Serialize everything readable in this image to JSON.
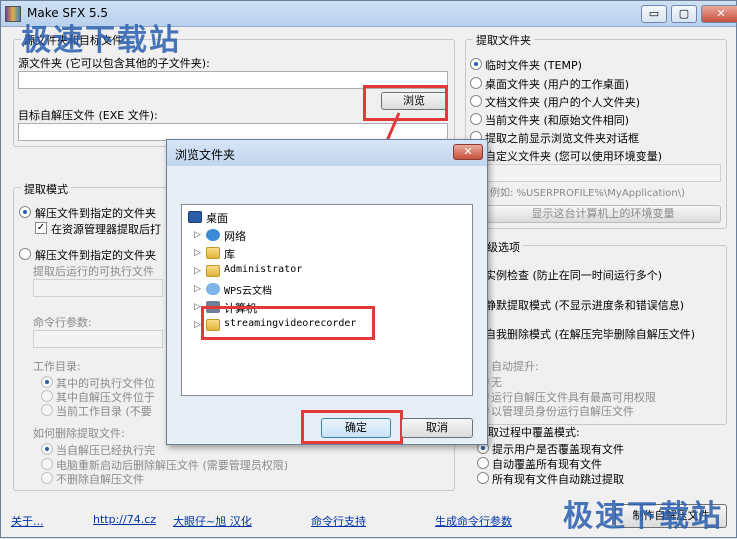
{
  "window": {
    "title": "Make SFX 5.5",
    "minimize": "▭",
    "maximize": "▢",
    "close": "✕"
  },
  "watermark": "极速下载站",
  "source_group": {
    "label": "源文件夹和目标文件",
    "source_label": "源文件夹 (它可以包含其他的子文件夹):",
    "browse_button": "浏览",
    "target_label": "目标自解压文件 (EXE 文件):"
  },
  "extract_mode": {
    "label": "提取模式",
    "opt1": "解压文件到指定的文件夹",
    "opt1_check": "在资源管理器提取后打",
    "opt2": "解压文件到指定的文件夹",
    "run_label": "提取后运行的可执行文件",
    "cmd_label": "命令行参数:",
    "workdir_label": "工作目录:",
    "wd1": "其中的可执行文件位",
    "wd2": "其中自解压文件位于",
    "wd3": "当前工作目录 (不要",
    "delete_label": "如何删除提取文件:",
    "del1": "当自解压已经执行完",
    "del2": "电脑重新启动后删除解压文件 (需要管理员权限)",
    "del3": "不删除自解压文件"
  },
  "extract_folder": {
    "label": "提取文件夹",
    "opt1": "临时文件夹 (TEMP)",
    "opt2": "桌面文件夹 (用户的工作桌面)",
    "opt3": "文档文件夹 (用户的个人文件夹)",
    "opt4": "当前文件夹 (和原始文件相同)",
    "opt5": "提取之前显示浏览文件夹对话框",
    "opt6": "自定义文件夹 (您可以使用环境变量)",
    "example": "例如: %USERPROFILE%\\MyApplication\\)",
    "env_button": "显示这台计算机上的环境变量"
  },
  "advanced": {
    "label": "高级选项",
    "opt1": "实例检查 (防止在同一时间运行多个)",
    "opt2": "静默提取模式 (不显示进度条和错误信息)",
    "opt3": "自我删除模式 (在解压完毕删除自解压文件)",
    "elevate_label": "自动提升:",
    "el1": "无",
    "el2": "运行自解压文件具有最高可用权限",
    "el3": "以管理员身份运行自解压文件"
  },
  "overwrite": {
    "label": "提取过程中覆盖模式:",
    "opt1": "提示用户是否覆盖现有文件",
    "opt2": "自动覆盖所有现有文件",
    "opt3": "所有现有文件自动跳过提取"
  },
  "footer": {
    "about": "关于...",
    "site": "http://74.cz",
    "credit": "大眼仔~旭 汉化",
    "cmd_support": "命令行支持",
    "gen_cmd": "生成命令行参数",
    "make_button": "制作自解压文件"
  },
  "dialog": {
    "title": "浏览文件夹",
    "close": "✕",
    "tree": [
      {
        "label": "桌面",
        "icon": "desktop-icon"
      },
      {
        "label": "网络",
        "icon": "network-icon"
      },
      {
        "label": "库",
        "icon": "library-icon"
      },
      {
        "label": "Administrator",
        "icon": "user-folder-icon"
      },
      {
        "label": "WPS云文档",
        "icon": "cloud-icon"
      },
      {
        "label": "计算机",
        "icon": "computer-icon"
      },
      {
        "label": "streamingvideorecorder",
        "icon": "folder-icon"
      }
    ],
    "ok": "确定",
    "cancel": "取消"
  },
  "colors": {
    "highlight": "#e2393b",
    "accent": "#2a5fb0",
    "link": "#0033aa"
  }
}
